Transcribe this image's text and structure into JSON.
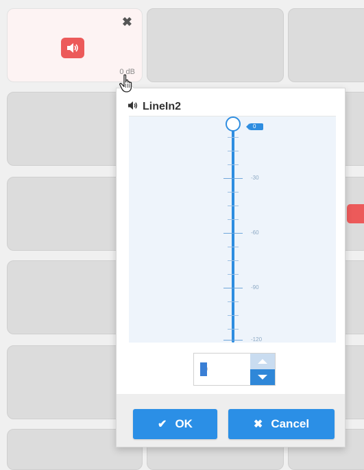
{
  "active_tile": {
    "level_label": "0 dB",
    "close_glyph": "✖",
    "mute_icon": "speaker-muted-icon"
  },
  "popup": {
    "title": "LineIn2",
    "title_icon": "speaker-icon",
    "slider": {
      "value": 0,
      "min": -120,
      "max": 0,
      "value_label": "0",
      "scale_labels": [
        "-30",
        "-60",
        "-90",
        "-120"
      ]
    },
    "stepper": {
      "value": "0"
    },
    "ok_button": {
      "label": "OK",
      "glyph": "✔"
    },
    "cancel_button": {
      "label": "Cancel",
      "glyph": "✖"
    }
  },
  "colors": {
    "accent_blue": "#2b8fe6",
    "mute_red": "#ec5a5a",
    "tile_gray": "#dcdcdc"
  }
}
